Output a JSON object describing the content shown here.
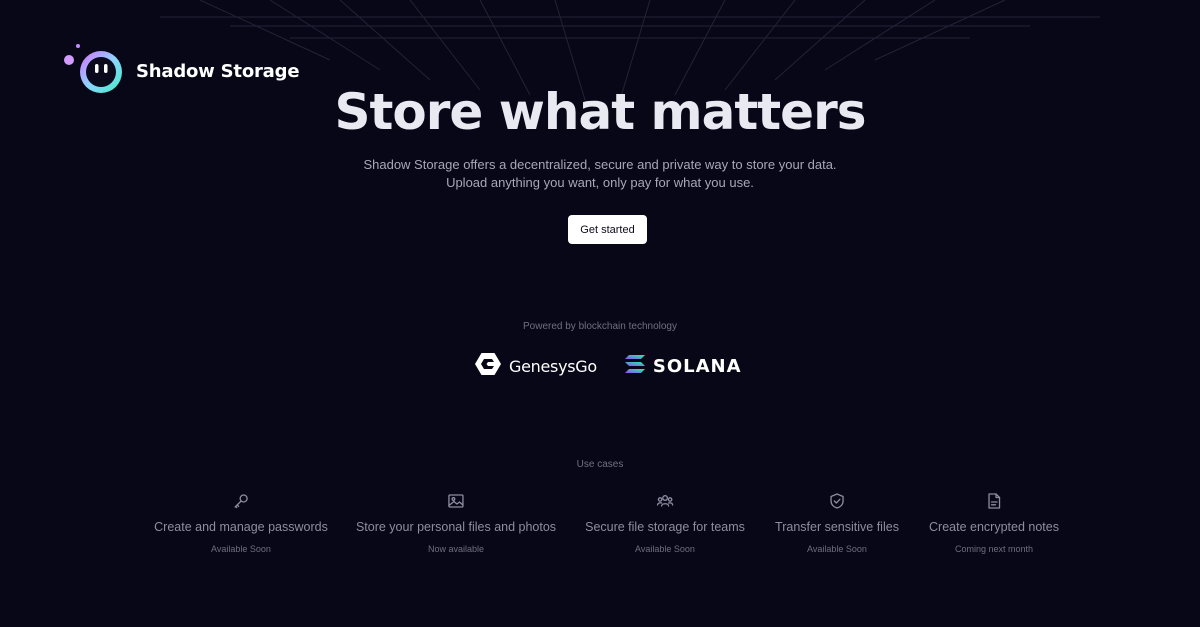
{
  "brand": {
    "name": "Shadow Storage"
  },
  "hero": {
    "title": "Store what matters",
    "subtitle_line1": "Shadow Storage offers a decentralized, secure and private way to store your data.",
    "subtitle_line2": "Upload anything you want, only pay for what you use.",
    "cta_label": "Get started"
  },
  "powered": {
    "label": "Powered by blockchain technology",
    "partners": [
      {
        "name": "GenesysGo",
        "icon": "genesysgo-logo"
      },
      {
        "name": "SOLANA",
        "icon": "solana-logo"
      }
    ]
  },
  "use_cases": {
    "heading": "Use cases",
    "items": [
      {
        "title": "Create and manage passwords",
        "status": "Available Soon",
        "icon": "key-icon"
      },
      {
        "title": "Store your personal files and photos",
        "status": "Now available",
        "icon": "image-icon"
      },
      {
        "title": "Secure file storage for teams",
        "status": "Available Soon",
        "icon": "team-icon"
      },
      {
        "title": "Transfer sensitive files",
        "status": "Available Soon",
        "icon": "shield-icon"
      },
      {
        "title": "Create encrypted notes",
        "status": "Coming next month",
        "icon": "document-icon"
      }
    ]
  },
  "colors": {
    "background": "#070717",
    "cta_background": "#ffffff",
    "muted_text": "#8d8da0"
  }
}
